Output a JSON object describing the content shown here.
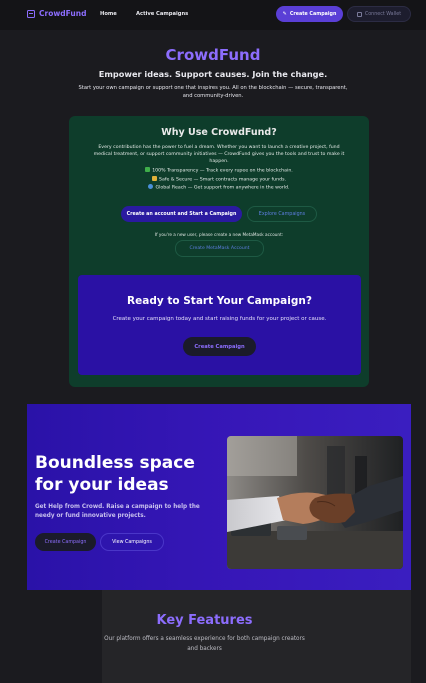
{
  "nav": {
    "brand": "CrowdFund",
    "links": [
      "Home",
      "Active Campaigns"
    ],
    "create_button": "Create Campaign",
    "wallet_button": "Connect Wallet"
  },
  "hero": {
    "title": "CrowdFund",
    "subtitle": "Empower ideas. Support causes. Join the change.",
    "description": "Start your own campaign or support one that inspires you. All on the blockchain — secure, transparent, and community-driven."
  },
  "why": {
    "title": "Why Use CrowdFund?",
    "text": "Every contribution has the power to fuel a dream. Whether you want to launch a creative project, fund medical treatment, or support community initiatives — CrowdFund gives you the tools and trust to make it happen.",
    "points": [
      {
        "icon": "check-icon",
        "text": "100% Transparency — Track every rupee on the blockchain."
      },
      {
        "icon": "lock-icon",
        "text": "Safe & Secure — Smart contracts manage your funds."
      },
      {
        "icon": "globe-icon",
        "text": "Global Reach — Get support from anywhere in the world."
      }
    ],
    "start_button": "Create an account and Start a Campaign",
    "explore_button": "Explore Campaigns",
    "note": "If you're a new user, please create a new MetaMask account:",
    "metamask_button": "Create MetaMask Account"
  },
  "ready": {
    "title": "Ready to Start Your Campaign?",
    "text": "Create your campaign today and start raising funds for your project or cause.",
    "button": "Create Campaign"
  },
  "boundless": {
    "title": "Boundless space for your ideas",
    "text": "Get Help from Crowd. Raise a campaign to help the needy or fund innovative projects.",
    "create_button": "Create Campaign",
    "view_button": "View Campaigns"
  },
  "features": {
    "title": "Key Features",
    "text": "Our platform offers a seamless experience for both campaign creators and backers"
  },
  "colors": {
    "accent": "#8c6dfd",
    "page_bg": "#1b1b1f",
    "why_bg": "#0e3d2b",
    "ready_bg": "#2a11a4"
  }
}
